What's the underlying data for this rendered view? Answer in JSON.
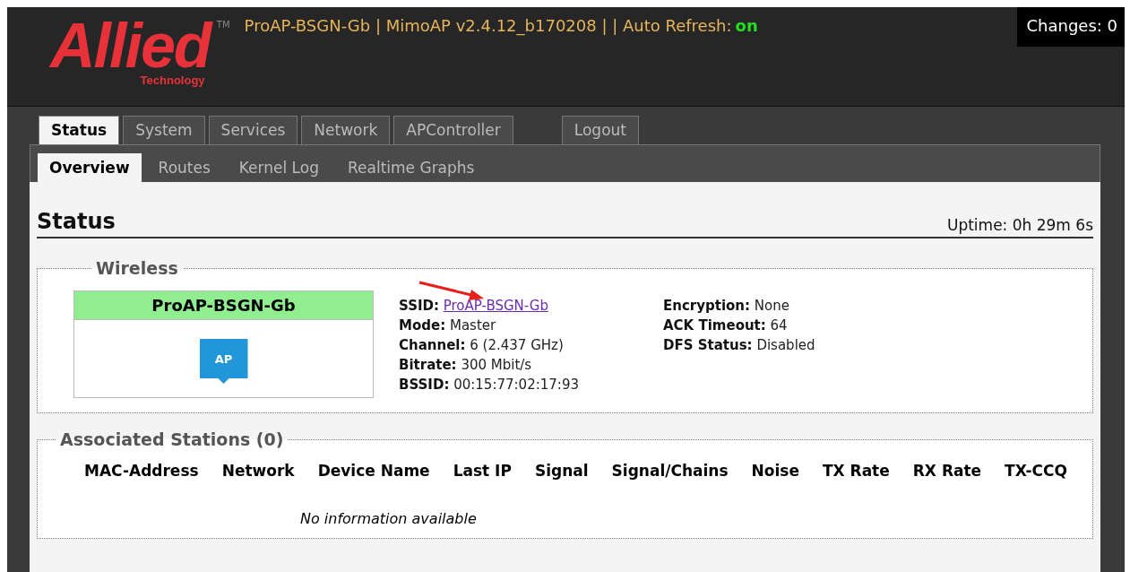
{
  "header": {
    "logo": "Allied",
    "logo_tm": "TM",
    "logo_sub": "Technology",
    "info": "ProAP-BSGN-Gb | MimoAP v2.4.12_b170208 | | Auto Refresh:",
    "auto_refresh": "on",
    "changes": "Changes: 0"
  },
  "tabs": [
    {
      "label": "Status",
      "selected": true
    },
    {
      "label": "System",
      "selected": false
    },
    {
      "label": "Services",
      "selected": false
    },
    {
      "label": "Network",
      "selected": false
    },
    {
      "label": "APController",
      "selected": false
    },
    {
      "label": "Logout",
      "selected": false
    }
  ],
  "subtabs": [
    {
      "label": "Overview",
      "selected": true
    },
    {
      "label": "Routes",
      "selected": false
    },
    {
      "label": "Kernel Log",
      "selected": false
    },
    {
      "label": "Realtime Graphs",
      "selected": false
    }
  ],
  "page": {
    "title": "Status",
    "uptime": "Uptime: 0h 29m 6s"
  },
  "wireless": {
    "legend": "Wireless",
    "card": {
      "name": "ProAP-BSGN-Gb",
      "badge": "AP"
    },
    "columns": [
      [
        {
          "label": "SSID:",
          "value": "ProAP-BSGN-Gb",
          "kind": "link"
        },
        {
          "label": "Mode:",
          "value": "Master",
          "kind": "text"
        },
        {
          "label": "Channel:",
          "value": "6 (2.437 GHz)",
          "kind": "text"
        },
        {
          "label": "Bitrate:",
          "value": "300 Mbit/s",
          "kind": "text"
        },
        {
          "label": "BSSID:",
          "value": "00:15:77:02:17:93",
          "kind": "text"
        }
      ],
      [
        {
          "label": "Encryption:",
          "value": "None",
          "kind": "text"
        },
        {
          "label": "ACK Timeout:",
          "value": "64",
          "kind": "text"
        },
        {
          "label": "DFS Status:",
          "value": "Disabled",
          "kind": "text"
        }
      ]
    ]
  },
  "stations": {
    "legend": "Associated Stations (0)",
    "columns": [
      "MAC-Address",
      "Network",
      "Device Name",
      "Last IP",
      "Signal",
      "Signal/Chains",
      "Noise",
      "TX Rate",
      "RX Rate",
      "TX-CCQ"
    ],
    "empty": "No information available"
  }
}
